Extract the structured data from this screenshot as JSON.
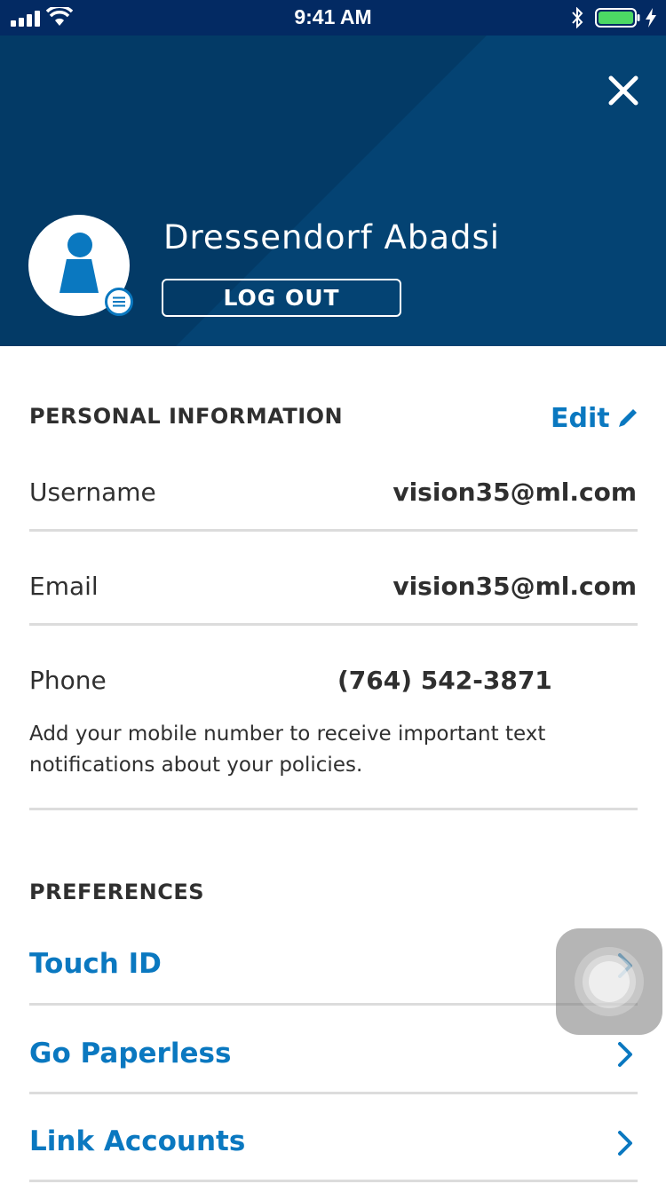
{
  "status_bar": {
    "time": "9:41 AM"
  },
  "profile": {
    "name": "Dressendorf Abadsi",
    "logout_label": "LOG OUT"
  },
  "personal_information": {
    "title": "PERSONAL INFORMATION",
    "edit_label": "Edit",
    "rows": [
      {
        "label": "Username",
        "value": "vision35@ml.com"
      },
      {
        "label": "Email",
        "value": "vision35@ml.com"
      },
      {
        "label": "Phone",
        "value": "(764) 542-3871"
      }
    ],
    "phone_help": "Add your mobile number to receive important text notifications about your policies."
  },
  "preferences": {
    "title": "PREFERENCES",
    "items": [
      {
        "label": "Touch ID"
      },
      {
        "label": "Go Paperless"
      },
      {
        "label": "Link Accounts"
      }
    ]
  },
  "colors": {
    "header_bg": "#044373",
    "status_bar_bg": "#032a63",
    "accent": "#0a78c0",
    "battery": "#4cd964"
  }
}
